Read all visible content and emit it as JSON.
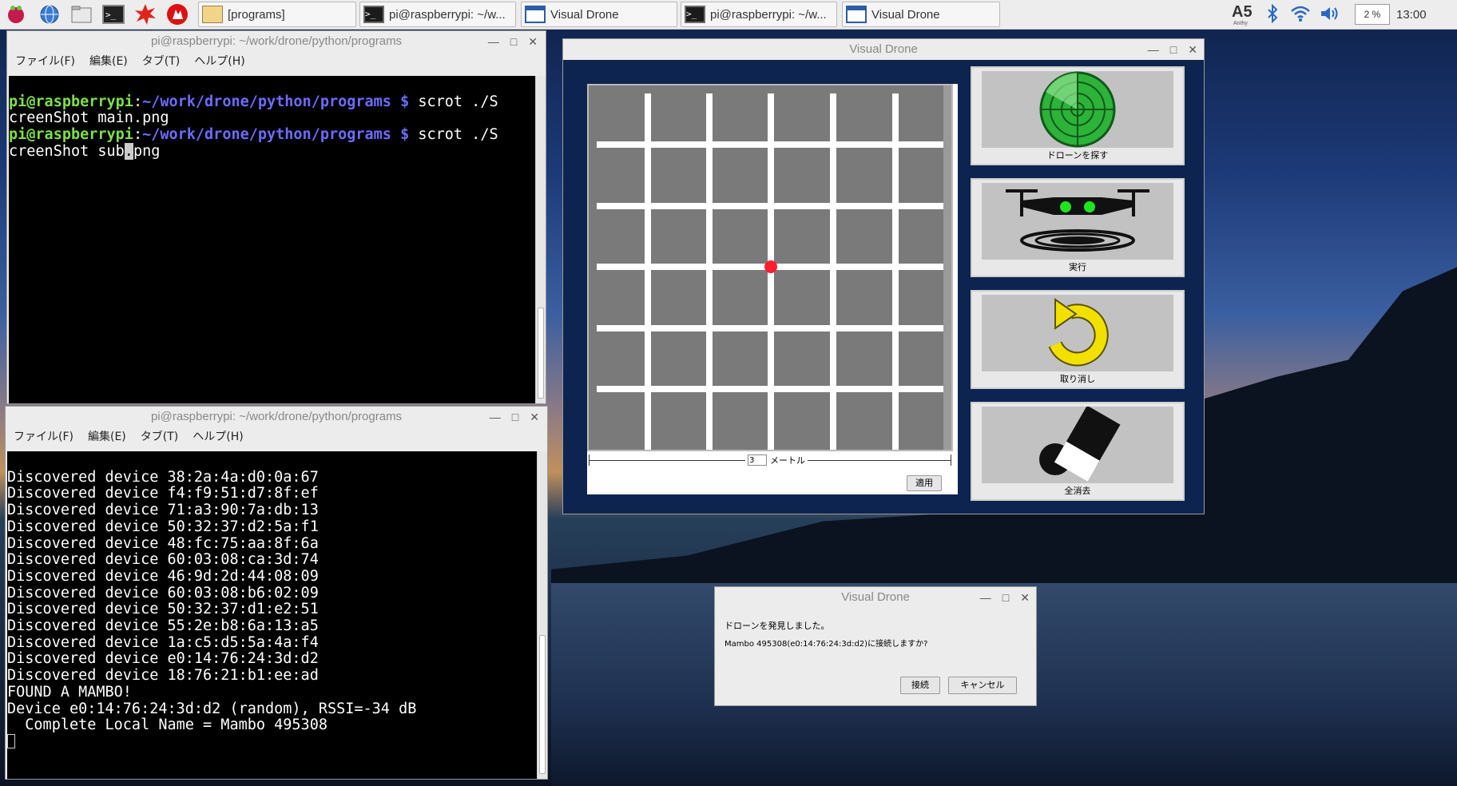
{
  "taskbar": {
    "tasks": [
      {
        "label": "[programs]",
        "icon": "folder-icon"
      },
      {
        "label": "pi@raspberrypi: ~/w...",
        "icon": "terminal-icon"
      },
      {
        "label": "Visual Drone",
        "icon": "window-icon"
      },
      {
        "label": "pi@raspberrypi: ~/w...",
        "icon": "terminal-icon"
      },
      {
        "label": "Visual Drone",
        "icon": "window-icon"
      }
    ],
    "tray": {
      "ime": "A5",
      "ime_sub": "Anthy",
      "cpu": "2 %",
      "clock": "13:00"
    }
  },
  "terminal1": {
    "title": "pi@raspberrypi: ~/work/drone/python/programs",
    "menu": [
      "ファイル(F)",
      "編集(E)",
      "タブ(T)",
      "ヘルプ(H)"
    ],
    "lines": [
      {
        "user": "pi@raspberrypi",
        "sep": ":",
        "path": "~/work/drone/python/programs $",
        "cmd": " scrot ./S"
      },
      {
        "text": "creenShot main.png"
      },
      {
        "user": "pi@raspberrypi",
        "sep": ":",
        "path": "~/work/drone/python/programs $",
        "cmd": " scrot ./S"
      },
      {
        "text_before": "creenShot sub",
        "cursor": ".",
        "text_after": "png"
      }
    ]
  },
  "terminal2": {
    "title": "pi@raspberrypi: ~/work/drone/python/programs",
    "menu": [
      "ファイル(F)",
      "編集(E)",
      "タブ(T)",
      "ヘルプ(H)"
    ],
    "lines": [
      "Discovered device 38:2a:4a:d0:0a:67",
      "Discovered device f4:f9:51:d7:8f:ef",
      "Discovered device 71:a3:90:7a:db:13",
      "Discovered device 50:32:37:d2:5a:f1",
      "Discovered device 48:fc:75:aa:8f:6a",
      "Discovered device 60:03:08:ca:3d:74",
      "Discovered device 46:9d:2d:44:08:09",
      "Discovered device 60:03:08:b6:02:09",
      "Discovered device 50:32:37:d1:e2:51",
      "Discovered device 55:2e:b8:6a:13:a5",
      "Discovered device 1a:c5:d5:5a:4a:f4",
      "Discovered device e0:14:76:24:3d:d2",
      "Discovered device 18:76:21:b1:ee:ad",
      "FOUND A MAMBO!",
      "Device e0:14:76:24:3d:d2 (random), RSSI=-34 dB",
      "  Complete Local Name = Mambo 495308"
    ]
  },
  "visual_drone": {
    "title": "Visual Drone",
    "scale_value": "3",
    "scale_unit": "メートル",
    "apply_label": "適用",
    "buttons": [
      {
        "label": "ドローンを探す",
        "icon": "radar-icon"
      },
      {
        "label": "実行",
        "icon": "drone-icon"
      },
      {
        "label": "取り消し",
        "icon": "undo-arrow-icon"
      },
      {
        "label": "全消去",
        "icon": "eraser-icon"
      }
    ]
  },
  "dialog": {
    "title": "Visual Drone",
    "message1": "ドローンを発見しました。",
    "message2": "Mambo 495308(e0:14:76:24:3d:d2)に接続しますか?",
    "ok_label": "接続",
    "cancel_label": "キャンセル"
  },
  "colors": {
    "prompt_user": "#7ee044",
    "prompt_path": "#6c6cff",
    "drone_bg": "#0e2450",
    "grid_cell": "#7a7a7a",
    "target_dot": "#ff1f2f"
  }
}
